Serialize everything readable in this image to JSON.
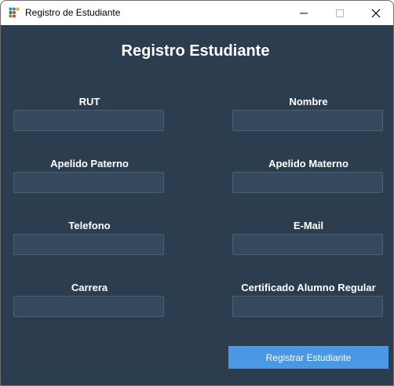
{
  "window": {
    "title": "Registro de Estudiante",
    "app_icon": "grid-dots-icon",
    "controls": [
      "minimize-icon",
      "maximize-icon",
      "close-icon"
    ]
  },
  "form": {
    "heading": "Registro Estudiante",
    "fields": {
      "rut": {
        "label": "RUT",
        "value": ""
      },
      "nombre": {
        "label": "Nombre",
        "value": ""
      },
      "apellido_paterno": {
        "label": "Apelido Paterno",
        "value": ""
      },
      "apellido_materno": {
        "label": "Apelido Materno",
        "value": ""
      },
      "telefono": {
        "label": "Telefono",
        "value": ""
      },
      "email": {
        "label": "E-Mail",
        "value": ""
      },
      "carrera": {
        "label": "Carrera",
        "value": ""
      },
      "certificado": {
        "label": "Certificado Alumno Regular",
        "value": ""
      }
    },
    "submit_label": "Registrar Estudiante"
  },
  "colors": {
    "background": "#2b3d4f",
    "field": "#34495e",
    "accent": "#4a98e3",
    "text": "#ffffff"
  }
}
